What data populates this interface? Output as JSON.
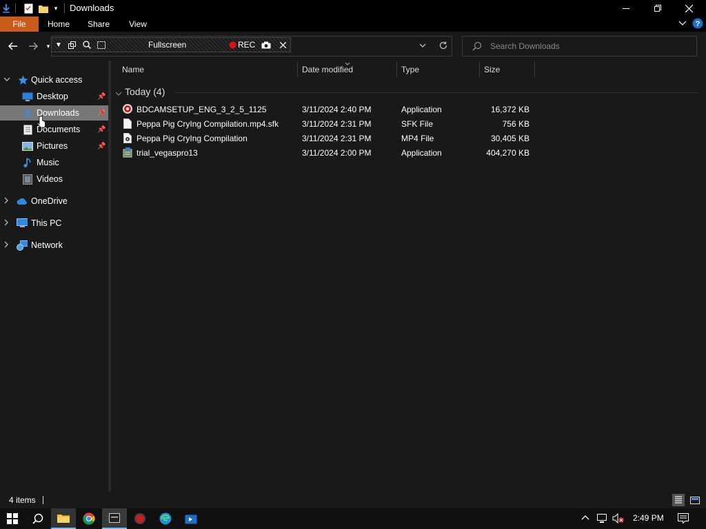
{
  "window": {
    "title": "Downloads"
  },
  "ribbon": {
    "tabs": [
      "File",
      "Home",
      "Share",
      "View"
    ]
  },
  "recorder": {
    "fullscreen_label": "Fullscreen",
    "rec_label": "REC"
  },
  "search": {
    "placeholder": "Search Downloads"
  },
  "nav": {
    "quick_access": "Quick access",
    "items": [
      {
        "label": "Desktop",
        "icon": "desktop-icon",
        "pinned": true
      },
      {
        "label": "Downloads",
        "icon": "downloads-icon",
        "pinned": true,
        "selected": true
      },
      {
        "label": "Documents",
        "icon": "documents-icon",
        "pinned": true
      },
      {
        "label": "Pictures",
        "icon": "pictures-icon",
        "pinned": true
      },
      {
        "label": "Music",
        "icon": "music-icon",
        "pinned": false
      },
      {
        "label": "Videos",
        "icon": "videos-icon",
        "pinned": false
      }
    ],
    "roots": [
      {
        "label": "OneDrive",
        "icon": "onedrive-icon"
      },
      {
        "label": "This PC",
        "icon": "this-pc-icon"
      },
      {
        "label": "Network",
        "icon": "network-icon"
      }
    ]
  },
  "columns": {
    "name": "Name",
    "date": "Date modified",
    "type": "Type",
    "size": "Size"
  },
  "group": {
    "label": "Today (4)"
  },
  "files": [
    {
      "name": "BDCAMSETUP_ENG_3_2_5_1125",
      "date": "3/11/2024 2:40 PM",
      "type": "Application",
      "size": "16,372 KB",
      "icon": "bandicam-installer-icon"
    },
    {
      "name": "Peppa Pig CryIng Compilation.mp4.sfk",
      "date": "3/11/2024 2:31 PM",
      "type": "SFK File",
      "size": "756 KB",
      "icon": "file-icon"
    },
    {
      "name": "Peppa Pig CryIng Compilation",
      "date": "3/11/2024 2:31 PM",
      "type": "MP4 File",
      "size": "30,405 KB",
      "icon": "video-file-icon"
    },
    {
      "name": "trial_vegaspro13",
      "date": "3/11/2024 2:00 PM",
      "type": "Application",
      "size": "404,270 KB",
      "icon": "installer-icon"
    }
  ],
  "status": {
    "count": "4 items"
  },
  "taskbar": {
    "time": "2:49 PM"
  },
  "colors": {
    "accent_file_tab": "#c85a1a",
    "selected_nav": "#777777",
    "background": "#191919"
  }
}
